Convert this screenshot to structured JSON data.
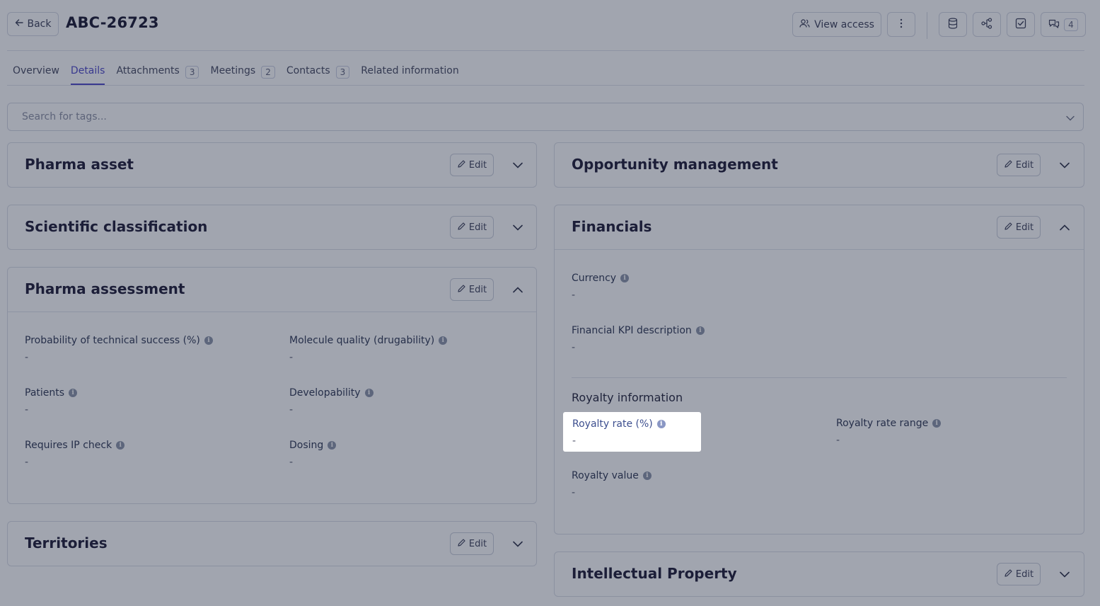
{
  "header": {
    "back_label": "Back",
    "title": "ABC-26723",
    "view_access_label": "View access",
    "comments_count": "4"
  },
  "tabs": [
    {
      "label": "Overview",
      "count": null,
      "active": false
    },
    {
      "label": "Details",
      "count": null,
      "active": true
    },
    {
      "label": "Attachments",
      "count": "3",
      "active": false
    },
    {
      "label": "Meetings",
      "count": "2",
      "active": false
    },
    {
      "label": "Contacts",
      "count": "3",
      "active": false
    },
    {
      "label": "Related information",
      "count": null,
      "active": false
    }
  ],
  "search": {
    "placeholder": "Search for tags..."
  },
  "edit_label": "Edit",
  "cards": {
    "pharma_asset": {
      "title": "Pharma asset"
    },
    "scientific_classification": {
      "title": "Scientific classification"
    },
    "pharma_assessment": {
      "title": "Pharma assessment",
      "fields": [
        {
          "label": "Probability of technical success (%)",
          "value": "-"
        },
        {
          "label": "Molecule quality (drugability)",
          "value": "-"
        },
        {
          "label": "Patients",
          "value": "-"
        },
        {
          "label": "Developability",
          "value": "-"
        },
        {
          "label": "Requires IP check",
          "value": "-"
        },
        {
          "label": "Dosing",
          "value": "-"
        }
      ]
    },
    "territories": {
      "title": "Territories"
    },
    "opportunity_management": {
      "title": "Opportunity management"
    },
    "financials": {
      "title": "Financials",
      "fields": [
        {
          "label": "Currency",
          "value": "-"
        },
        {
          "label": "Financial KPI description",
          "value": "-"
        }
      ],
      "royalty_heading": "Royalty information",
      "royalty_fields": [
        {
          "label": "Royalty rate (%)",
          "value": "-"
        },
        {
          "label": "Royalty rate range",
          "value": "-"
        },
        {
          "label": "Royalty value",
          "value": "-"
        }
      ]
    },
    "intellectual_property": {
      "title": "Intellectual Property"
    }
  },
  "colors": {
    "accent": "#4c46c8",
    "overlay": "rgba(32,40,64,0.42)"
  }
}
